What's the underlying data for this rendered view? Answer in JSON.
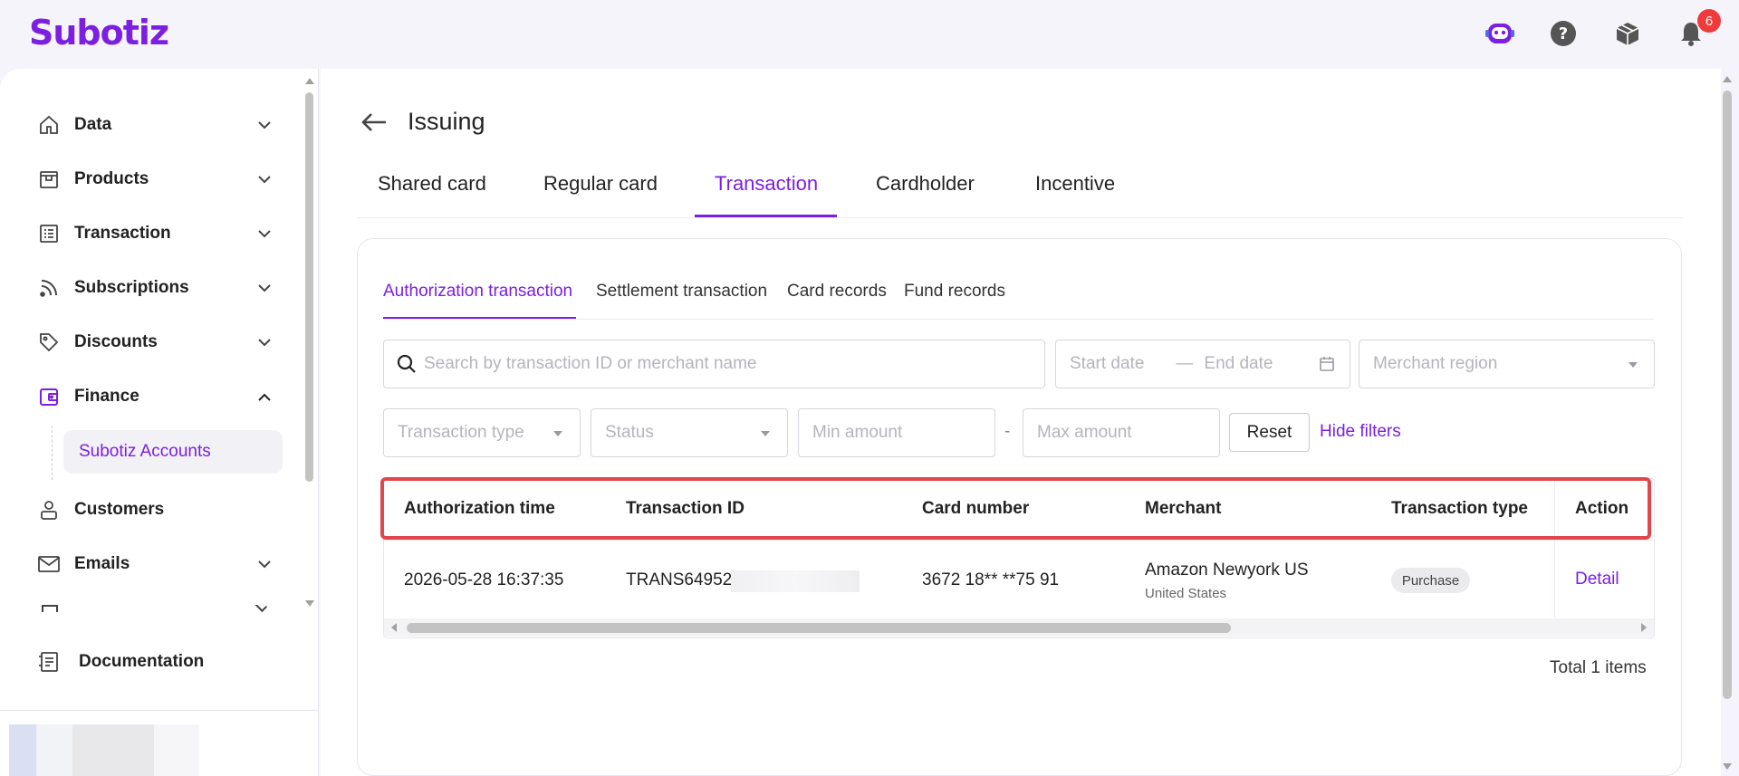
{
  "brand": {
    "logo": "Subotiz",
    "accent": "#7b1fe0"
  },
  "topbar": {
    "notifications_count": "6"
  },
  "sidebar": {
    "items": [
      {
        "label": "Data",
        "icon": "home-icon"
      },
      {
        "label": "Products",
        "icon": "store-icon"
      },
      {
        "label": "Transaction",
        "icon": "list-icon"
      },
      {
        "label": "Subscriptions",
        "icon": "rss-icon"
      },
      {
        "label": "Discounts",
        "icon": "tag-icon"
      },
      {
        "label": "Finance",
        "icon": "wallet-icon"
      },
      {
        "label": "Customers",
        "icon": "user-icon"
      },
      {
        "label": "Emails",
        "icon": "mail-icon"
      },
      {
        "label": "Documentation",
        "icon": "doc-icon"
      }
    ],
    "finance_sub": "Subotiz Accounts"
  },
  "page": {
    "title": "Issuing",
    "tabs": [
      "Shared card",
      "Regular card",
      "Transaction",
      "Cardholder",
      "Incentive"
    ],
    "active_tab": "Transaction"
  },
  "subtabs": [
    "Authorization transaction",
    "Settlement transaction",
    "Card records",
    "Fund records"
  ],
  "filters": {
    "search_placeholder": "Search by transaction ID or merchant name",
    "start_date": "Start date",
    "end_date": "End date",
    "merchant_region": "Merchant region",
    "transaction_type": "Transaction type",
    "status": "Status",
    "min_amount": "Min amount",
    "max_amount": "Max amount",
    "range_sep": "-",
    "reset": "Reset",
    "hide_filters": "Hide filters"
  },
  "table": {
    "headers": [
      "Authorization time",
      "Transaction ID",
      "Card number",
      "Merchant",
      "Transaction type",
      "Action"
    ],
    "rows": [
      {
        "time": "2026-05-28 16:37:35",
        "transaction_id": "TRANS649529",
        "card_number": "3672 18** **75 91",
        "merchant": "Amazon Newyork US",
        "merchant_region": "United States",
        "type": "Purchase",
        "action": "Detail"
      }
    ],
    "total": "Total 1 items"
  }
}
